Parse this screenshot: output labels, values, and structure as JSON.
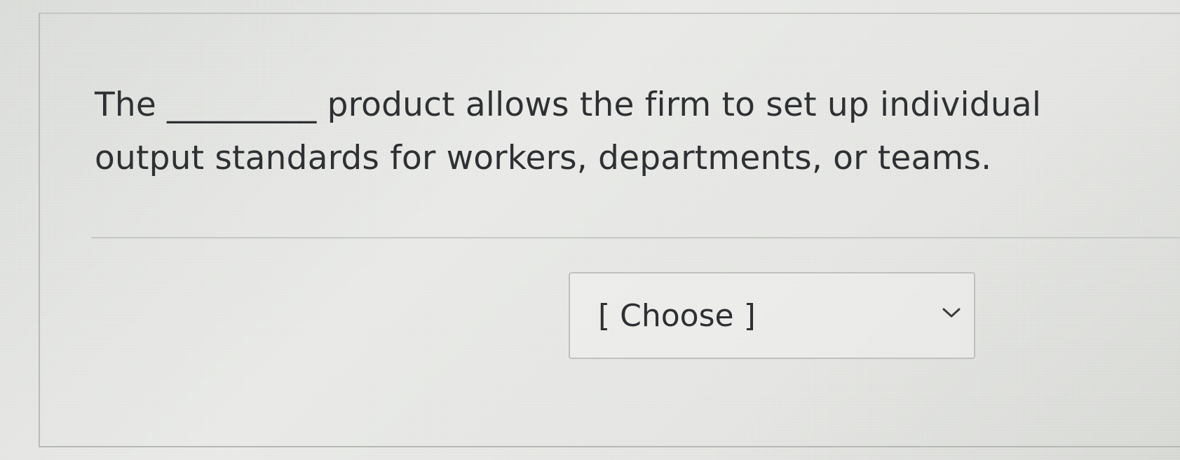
{
  "question": {
    "text": "The _________ product allows the firm to set up individual output standards for workers, departments, or teams."
  },
  "answer_select": {
    "selected_label": "[ Choose ]",
    "icon": "chevron-down-icon"
  }
}
